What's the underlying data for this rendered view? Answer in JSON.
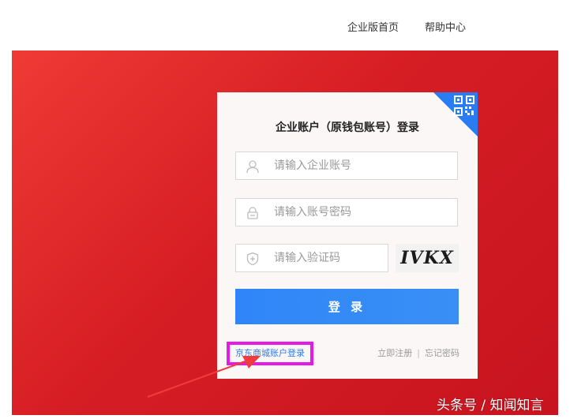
{
  "nav": {
    "enterprise_home": "企业版首页",
    "help_center": "帮助中心"
  },
  "login": {
    "title": "企业账户（原钱包账号）登录",
    "account_placeholder": "请输入企业账号",
    "password_placeholder": "请输入账号密码",
    "captcha_placeholder": "请输入验证码",
    "captcha_text": "IVKX",
    "submit_label": "登 录",
    "jd_login_link": "京东商城账户登录",
    "register_link": "立即注册",
    "forgot_link": "忘记密码",
    "link_separator": "|"
  },
  "watermark": "头条号 / 知闻知言",
  "colors": {
    "hero_red": "#d51d24",
    "accent_blue": "#2f86f8",
    "highlight_magenta": "#e619e6"
  },
  "icons": {
    "account": "user-icon",
    "password": "lock-icon",
    "captcha": "shield-icon",
    "qr": "qr-code-icon"
  }
}
